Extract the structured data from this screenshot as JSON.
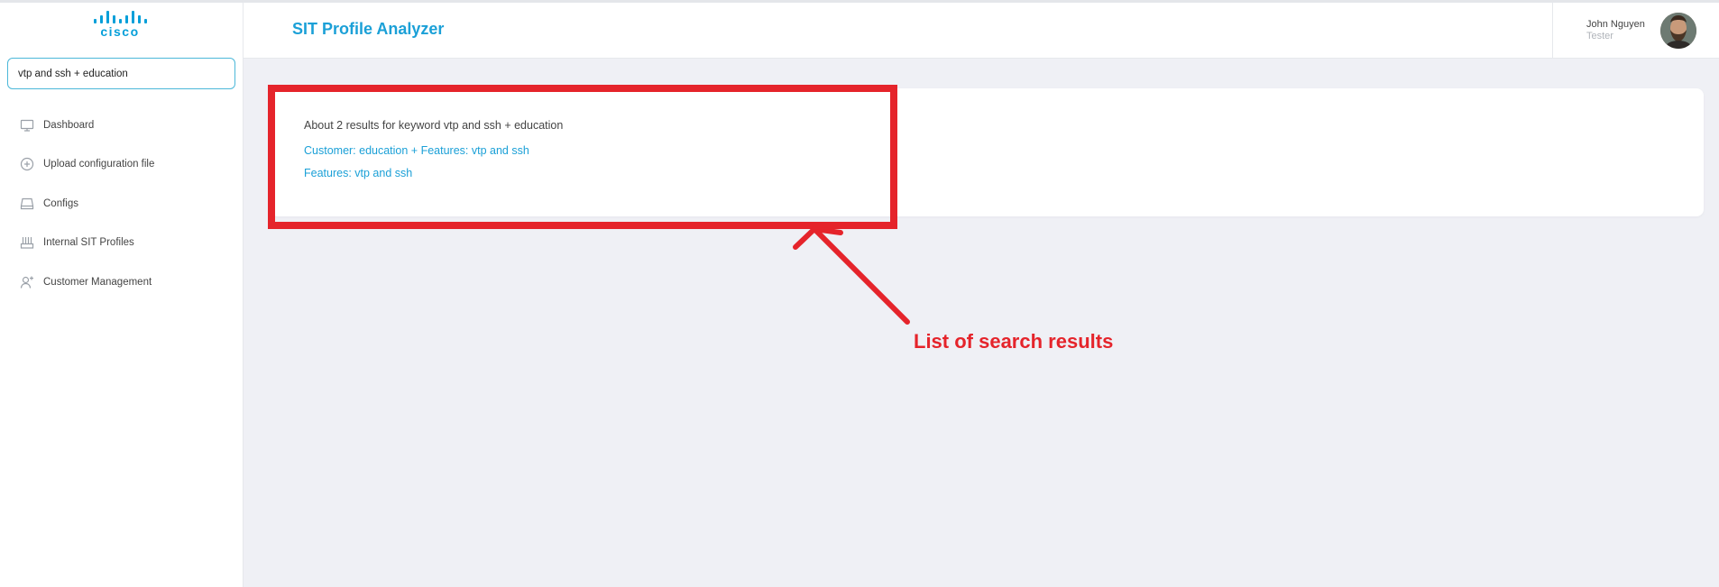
{
  "sidebar": {
    "logo_text": "cisco",
    "search_value": "vtp and ssh + education",
    "items": [
      {
        "label": "Dashboard",
        "icon": "monitor-icon"
      },
      {
        "label": "Upload configuration file",
        "icon": "plus-circle-icon"
      },
      {
        "label": "Configs",
        "icon": "drive-icon"
      },
      {
        "label": "Internal SIT Profiles",
        "icon": "router-icon"
      },
      {
        "label": "Customer Management",
        "icon": "add-user-icon"
      }
    ]
  },
  "header": {
    "title": "SIT Profile Analyzer",
    "user_name": "John Nguyen",
    "user_role": "Tester"
  },
  "results": {
    "summary": "About 2 results for keyword vtp and ssh + education",
    "items": [
      "Customer: education + Features: vtp and ssh",
      "Features: vtp and ssh"
    ]
  },
  "annotation": {
    "label": "List of search results",
    "color": "#e5242b"
  },
  "colors": {
    "accent": "#1ba0d7",
    "cisco_blue": "#049fd9",
    "background": "#eff0f5"
  }
}
